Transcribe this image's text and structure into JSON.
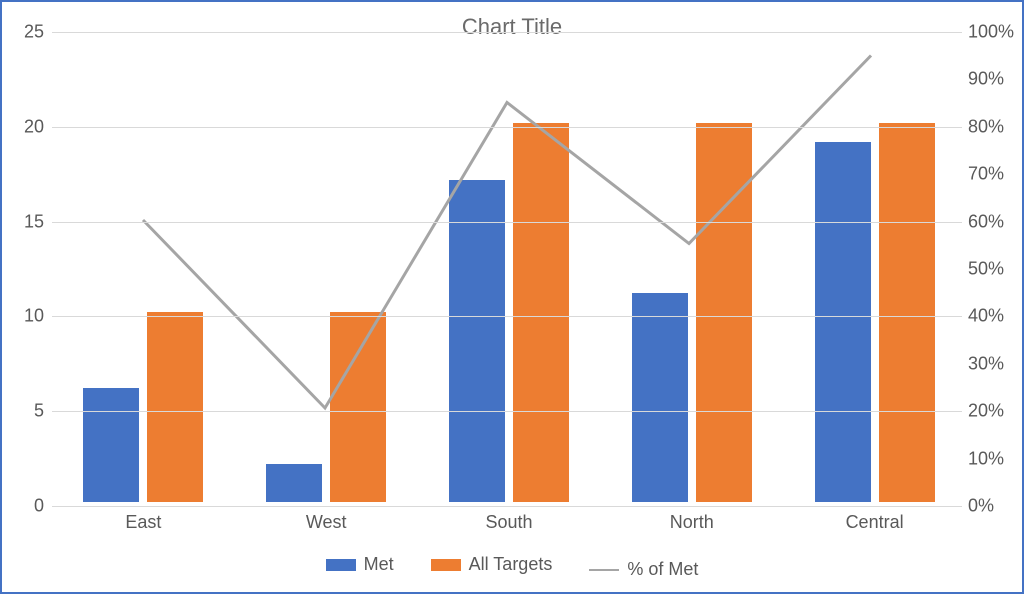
{
  "chart_data": {
    "type": "bar+line",
    "title": "Chart Title",
    "categories": [
      "East",
      "West",
      "South",
      "North",
      "Central"
    ],
    "series": [
      {
        "name": "Met",
        "values": [
          6,
          2,
          17,
          11,
          19
        ],
        "color": "#4472c4",
        "axis": "left",
        "kind": "bar"
      },
      {
        "name": "All Targets",
        "values": [
          10,
          10,
          20,
          20,
          20
        ],
        "color": "#ed7d31",
        "axis": "left",
        "kind": "bar"
      },
      {
        "name": "% of Met",
        "values": [
          60,
          20,
          85,
          55,
          95
        ],
        "color": "#a5a5a5",
        "axis": "right",
        "kind": "line"
      }
    ],
    "y_left": {
      "min": 0,
      "max": 25,
      "step": 5,
      "ticks": [
        0,
        5,
        10,
        15,
        20,
        25
      ]
    },
    "y_right": {
      "min": 0,
      "max": 100,
      "step": 10,
      "ticks_labels": [
        "0%",
        "10%",
        "20%",
        "30%",
        "40%",
        "50%",
        "60%",
        "70%",
        "80%",
        "90%",
        "100%"
      ],
      "ticks": [
        0,
        10,
        20,
        30,
        40,
        50,
        60,
        70,
        80,
        90,
        100
      ]
    },
    "legend": {
      "position": "bottom"
    }
  },
  "legend_labels": {
    "met": "Met",
    "all": "All Targets",
    "pct": "% of Met"
  }
}
